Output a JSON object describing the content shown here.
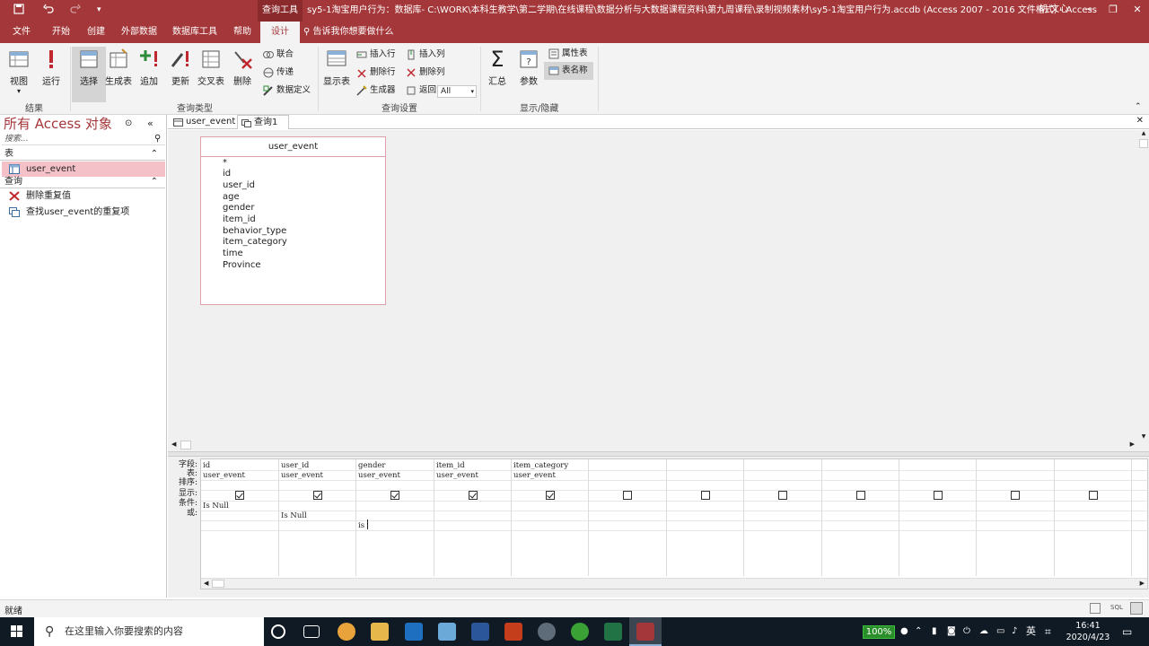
{
  "titlebar": {
    "context_tab": "查询工具",
    "title": "sy5-1淘宝用户行为：数据库- C:\\WORK\\本科生教学\\第二学期\\在线课程\\数据分析与大数据课程资料\\第九周课程\\录制视频素材\\sy5-1淘宝用户行为.accdb (Access 2007 - 2016 文件格式) - Access",
    "user": "胡 文心",
    "quick_access": [
      "save-icon",
      "undo-icon",
      "redo-icon",
      "customize-icon"
    ]
  },
  "menu": {
    "tabs": [
      "文件",
      "开始",
      "创建",
      "外部数据",
      "数据库工具",
      "帮助",
      "设计"
    ],
    "active": "设计",
    "tell_me": "告诉我你想要做什么"
  },
  "ribbon": {
    "results": {
      "label": "结果",
      "view": "视图",
      "run": "运行"
    },
    "query_type": {
      "label": "查询类型",
      "select": "选择",
      "make_table": "生成表",
      "append": "追加",
      "update": "更新",
      "crosstab": "交叉表",
      "delete": "删除",
      "union": "联合",
      "pass_through": "传递",
      "data_definition": "数据定义"
    },
    "query_setup": {
      "label": "查询设置",
      "show_table": "显示表",
      "insert_row": "插入行",
      "delete_row": "删除行",
      "builder": "生成器",
      "insert_col": "插入列",
      "delete_col": "删除列",
      "return": "返回:",
      "return_value": "All"
    },
    "show_hide": {
      "label": "显示/隐藏",
      "totals": "汇总",
      "params": "参数",
      "property_sheet": "属性表",
      "table_names": "表名称"
    }
  },
  "nav": {
    "title": "所有 Access 对象",
    "search_placeholder": "搜索...",
    "groups": [
      {
        "name": "表",
        "items": [
          "user_event"
        ]
      },
      {
        "name": "查询",
        "items": [
          "删除重复值",
          "查找user_event的重复项"
        ]
      }
    ]
  },
  "doc_tabs": [
    "user_event",
    "查询1"
  ],
  "field_list": {
    "table": "user_event",
    "fields": [
      "*",
      "id",
      "user_id",
      "age",
      "gender",
      "item_id",
      "behavior_type",
      "item_category",
      "time",
      "Province"
    ]
  },
  "grid": {
    "row_labels": [
      "字段:",
      "表:",
      "排序:",
      "显示:",
      "条件:",
      "或:"
    ],
    "columns": [
      {
        "field": "id",
        "table": "user_event",
        "show": true,
        "criteria": "Is Null",
        "or": ""
      },
      {
        "field": "user_id",
        "table": "user_event",
        "show": true,
        "criteria": "",
        "or": "Is Null"
      },
      {
        "field": "gender",
        "table": "user_event",
        "show": true,
        "criteria": "",
        "or2": "is"
      },
      {
        "field": "item_id",
        "table": "user_event",
        "show": true,
        "criteria": "",
        "or": ""
      },
      {
        "field": "item_category",
        "table": "user_event",
        "show": true,
        "criteria": "",
        "or": ""
      },
      {
        "field": "",
        "table": "",
        "show": false
      },
      {
        "field": "",
        "table": "",
        "show": false
      },
      {
        "field": "",
        "table": "",
        "show": false
      },
      {
        "field": "",
        "table": "",
        "show": false
      },
      {
        "field": "",
        "table": "",
        "show": false
      },
      {
        "field": "",
        "table": "",
        "show": false
      },
      {
        "field": "",
        "table": "",
        "show": false
      }
    ]
  },
  "status": {
    "text": "就绪"
  },
  "taskbar": {
    "search_placeholder": "在这里输入你要搜索的内容",
    "zoom": "100%",
    "ime": "英",
    "time": "16:41",
    "date": "2020/4/23"
  },
  "colors": {
    "access_red": "#a4373a",
    "selected_pink": "#f4c1c9"
  }
}
